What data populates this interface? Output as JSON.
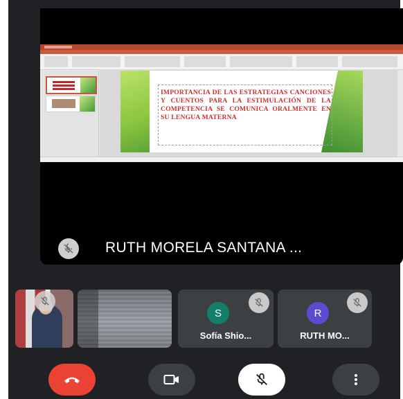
{
  "presentation": {
    "slide_title": "IMPORTANCIA DE LAS ESTRATEGIAS CANCIONES Y CUENTOS PARA LA ESTIMULACIÓN DE LA COMPETENCIA SE COMUNICA ORALMENTE EN SU LENGUA MATERNA"
  },
  "presenter": {
    "name": "RUTH MORELA SANTANA ...",
    "muted_icon": "mic-off-icon"
  },
  "participants": [
    {
      "initial": "S",
      "name": "Sofía Shio...",
      "color": "#137f6a"
    },
    {
      "initial": "R",
      "name": "RUTH MO...",
      "color": "#5c4bd1"
    }
  ],
  "controls": {
    "end_call": {
      "icon": "phone-hangup-icon",
      "color": "#ea4335"
    },
    "camera": {
      "icon": "camera-icon"
    },
    "microphone": {
      "icon": "mic-off-icon"
    },
    "more": {
      "icon": "more-vert-icon"
    }
  }
}
